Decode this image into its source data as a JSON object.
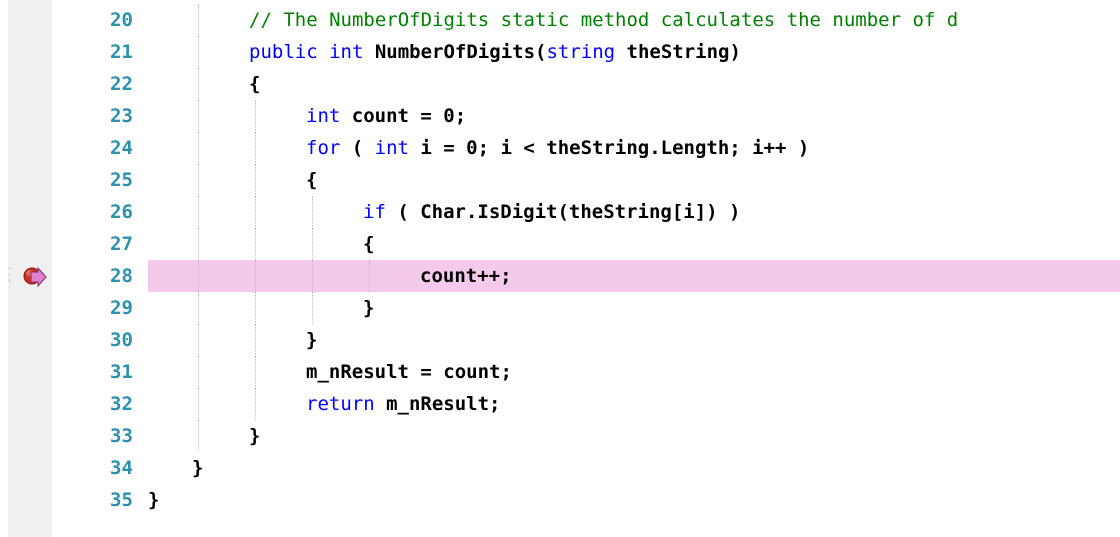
{
  "editor": {
    "lines": [
      {
        "num": "20",
        "indent": 2,
        "tokens": [
          {
            "t": "// The NumberOfDigits static method calculates the number of d",
            "c": "cm"
          }
        ]
      },
      {
        "num": "21",
        "indent": 2,
        "tokens": [
          {
            "t": "public",
            "c": "kw"
          },
          {
            "t": " "
          },
          {
            "t": "int",
            "c": "kw"
          },
          {
            "t": " NumberOfDigits("
          },
          {
            "t": "string",
            "c": "kw"
          },
          {
            "t": " theString)"
          }
        ]
      },
      {
        "num": "22",
        "indent": 2,
        "tokens": [
          {
            "t": "{"
          }
        ]
      },
      {
        "num": "23",
        "indent": 3,
        "tokens": [
          {
            "t": "int",
            "c": "kw"
          },
          {
            "t": " count = 0;"
          }
        ]
      },
      {
        "num": "24",
        "indent": 3,
        "tokens": [
          {
            "t": "for",
            "c": "kw"
          },
          {
            "t": " ( "
          },
          {
            "t": "int",
            "c": "kw"
          },
          {
            "t": " i = 0; i < theString.Length; i++ )"
          }
        ]
      },
      {
        "num": "25",
        "indent": 3,
        "tokens": [
          {
            "t": "{"
          }
        ]
      },
      {
        "num": "26",
        "indent": 4,
        "tokens": [
          {
            "t": "if",
            "c": "kw"
          },
          {
            "t": " ( Char.IsDigit(theString[i]) )"
          }
        ]
      },
      {
        "num": "27",
        "indent": 4,
        "tokens": [
          {
            "t": "{"
          }
        ]
      },
      {
        "num": "28",
        "indent": 5,
        "current": true,
        "tokens": [
          {
            "t": "count++;"
          }
        ]
      },
      {
        "num": "29",
        "indent": 4,
        "tokens": [
          {
            "t": "}"
          }
        ]
      },
      {
        "num": "30",
        "indent": 3,
        "tokens": [
          {
            "t": "}"
          }
        ]
      },
      {
        "num": "31",
        "indent": 3,
        "tokens": [
          {
            "t": "m_nResult = count;"
          }
        ]
      },
      {
        "num": "32",
        "indent": 3,
        "tokens": [
          {
            "t": "return",
            "c": "kw"
          },
          {
            "t": " m_nResult;"
          }
        ]
      },
      {
        "num": "33",
        "indent": 2,
        "tokens": [
          {
            "t": "}"
          }
        ]
      },
      {
        "num": "34",
        "indent": 1,
        "tokens": [
          {
            "t": "}"
          }
        ]
      },
      {
        "num": "35",
        "indent": 0,
        "tokens": [
          {
            "t": "}"
          }
        ]
      }
    ],
    "breakpoint": {
      "line": "28",
      "icon": "breakpoint-current-statement-icon",
      "color": "#d03020",
      "arrow_color": "#e080d0"
    }
  },
  "colors": {
    "line_number": "#2b91af",
    "keyword": "#0000ff",
    "comment": "#008000",
    "current_line_bg": "#f4c9ec",
    "gutter_bg": "#f0f0f0"
  }
}
